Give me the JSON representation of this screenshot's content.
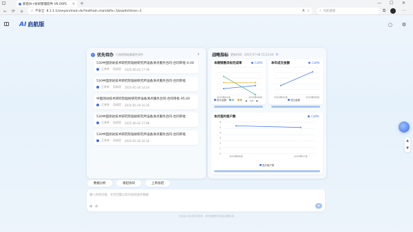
{
  "browser": {
    "tab_title": "新后AI+协同管理软件 V6.0SP1",
    "tab_close": "×",
    "new_tab": "+",
    "nav_back": "←",
    "nav_refresh": "⟳",
    "nav_home": "⌂",
    "security_label": "不安全",
    "url": "8.1.1.1/seeyon/main.do?method=main&fix=1&switchUser=1",
    "search_placeholder": "点此搜索",
    "win_min": "—",
    "win_max": "☐",
    "win_close": "✕",
    "more": "⋯"
  },
  "app": {
    "logo_mark": "AI",
    "logo_text": "启航版",
    "footer": "内容由AI生成仅供参考，请仔细甄别并核实重要信息"
  },
  "todo": {
    "title": "优先待办",
    "subtitle": "已按照智能重要性排序",
    "arrow": "›",
    "items": [
      {
        "title": "530中国测试技术研究院辐射研究所设备清点服务合同-合同审批-0.00",
        "user": "王李李",
        "tag": "【协同】",
        "time": "2025-06-02 17:39"
      },
      {
        "title": "530中国测试技术研究院辐射研究所设备清点服务合同-合同审批",
        "user": "王李李",
        "tag": "【协同】",
        "time": "2025-05-30 14:54"
      },
      {
        "title": "中国测试技术研究院辐射研究所设备清点服务合同-合同审批-95,00",
        "user": "王李李",
        "tag": "【协同】",
        "time": "2025-05-29 16:16"
      },
      {
        "title": "530中国测试技术研究院辐射研究所设备清点服务合同-合同审批",
        "user": "王李李",
        "tag": "【协同】",
        "time": "2025-06-02 17:08"
      },
      {
        "title": "530中国测试技术研究院辐射研究所设备清点服务合同-合同审批",
        "user": "王李李",
        "tag": "【协同】",
        "time": "2025-05-30 16:16"
      }
    ]
  },
  "kpi": {
    "title": "战略指标",
    "subtitle": "更新时间：2025-07-08 15:23:44",
    "refresh": "↻"
  },
  "chart_data": [
    {
      "type": "line",
      "title": "本期销售目标完成率",
      "link": "CoMA",
      "categories": [
        "2025年05月",
        "2025年06月"
      ],
      "series": [
        {
          "name": "部长金额",
          "values": [
            1.0,
            1.5
          ],
          "color": "#4d7cf5"
        },
        {
          "name": "年",
          "values": [
            3.0,
            0.0
          ],
          "color": "#4fb58a"
        },
        {
          "name": "年",
          "values": [
            2.0,
            2.0
          ],
          "color": "#f0b232"
        }
      ],
      "ylim": [
        0,
        4.5
      ],
      "pager": "1/3",
      "legend_prev": "◀",
      "legend_next": "▶"
    },
    {
      "type": "line",
      "title": "本年成交金额",
      "link": "CoMA",
      "categories": [
        "2025年05月",
        "2025年06月"
      ],
      "series": [
        {
          "name": "成交金额",
          "values": [
            1.0,
            2.5
          ],
          "color": "#4d7cf5"
        }
      ],
      "ylim": [
        0,
        3
      ]
    },
    {
      "type": "line",
      "title": "本月签约客户数",
      "link": "CoMA",
      "categories": [
        "2025年06月",
        "2025年07月"
      ],
      "yticks": [
        "6",
        "5",
        "4",
        "3",
        "2",
        "1",
        "0"
      ],
      "series": [
        {
          "name": "签约客户数",
          "values": [
            5.3,
            5.0
          ],
          "color": "#4d7cf5"
        }
      ],
      "ylim": [
        0,
        6
      ]
    }
  ],
  "quick_tabs": [
    "数据分析",
    "发起协同",
    "上周总结"
  ],
  "input": {
    "placeholder": "输入你的问题、任何问题以及内容相关的数据",
    "attach_icon": "⊕",
    "link_icon": "⊘",
    "send": "➤"
  },
  "float": {
    "up": "▲",
    "down": "▼"
  },
  "header": {
    "search_icon": "○",
    "settings_icon": "⚙"
  }
}
